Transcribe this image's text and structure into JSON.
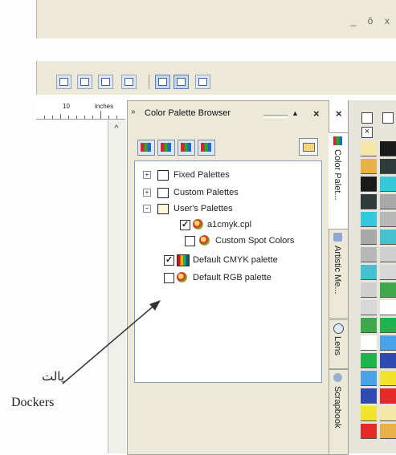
{
  "window": {
    "minimize": "_",
    "restore": "ô",
    "close": "x"
  },
  "ruler": {
    "number": "10",
    "unit": "inches"
  },
  "docker": {
    "grip": "»",
    "title": "Color Palette Browser",
    "pin": "▲",
    "close": "×",
    "outer_close": "×",
    "tree": [
      {
        "label": "Fixed Palettes"
      },
      {
        "label": "Custom Palettes"
      },
      {
        "label": "User's Palettes"
      },
      {
        "label": "a1cmyk.cpl"
      },
      {
        "label": "Custom Spot Colors"
      },
      {
        "label": "Default CMYK palette"
      },
      {
        "label": "Default RGB palette"
      }
    ],
    "expand": "+",
    "collapse": "−",
    "check": "✓"
  },
  "tabs": [
    {
      "label": "Color Palet..."
    },
    {
      "label": "Artistic Me..."
    },
    {
      "label": "Lens"
    },
    {
      "label": "Scrapbook"
    }
  ],
  "annotation": {
    "farsi": "پالت",
    "english": "Dockers"
  },
  "colors": {
    "palette_swatches": [
      "#f4e7a8",
      "#e8b24a",
      "#1a1a1a",
      "#2f3b3a",
      "#33c9d8",
      "#a8a8a8",
      "#b8b8b8",
      "#45c0ce",
      "#cfcfcf",
      "#d7d7d7",
      "#3fa84b",
      "#ffffff",
      "#1fb34c",
      "#4aa3e6",
      "#2d4bb0",
      "#f2e32c",
      "#e52a2a"
    ]
  }
}
